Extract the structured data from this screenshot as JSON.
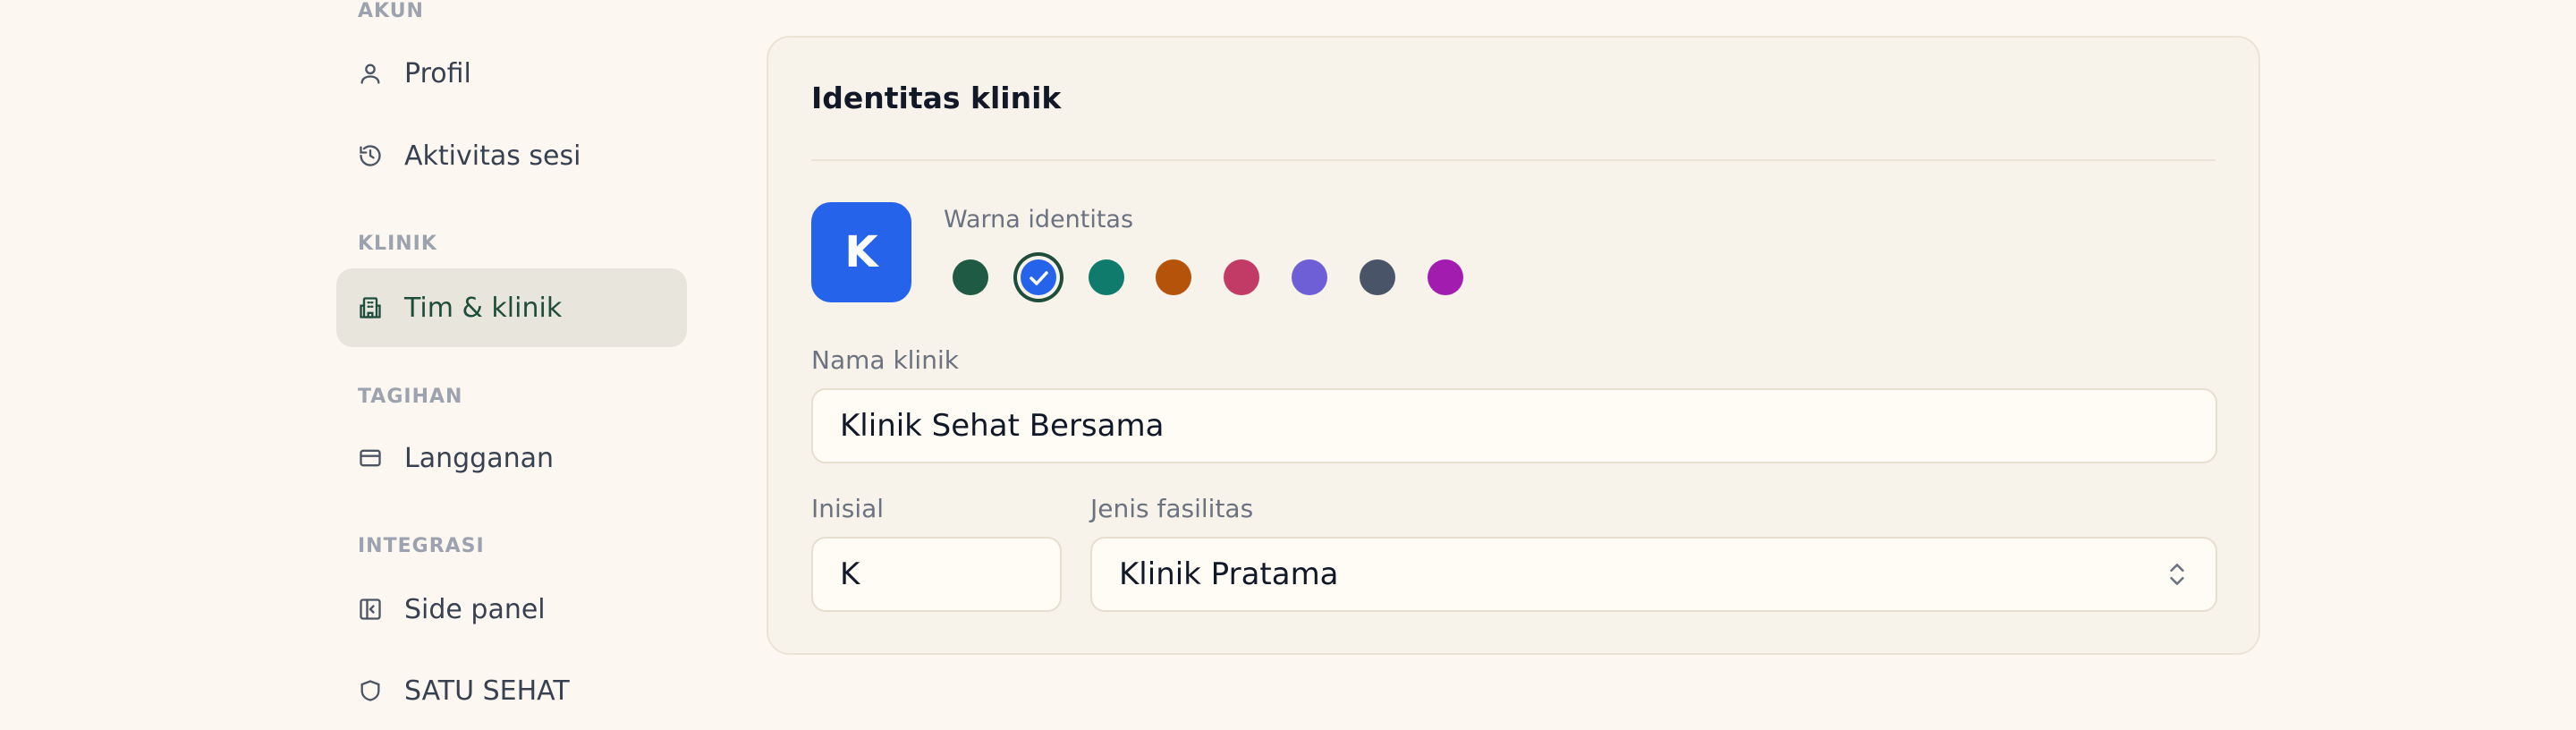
{
  "sidebar": {
    "sections": {
      "akun": "AKUN",
      "klinik": "KLINIK",
      "tagihan": "TAGIHAN",
      "integrasi": "INTEGRASI"
    },
    "items": {
      "profil": "Profil",
      "aktivitas": "Aktivitas sesi",
      "tim": "Tim & klinik",
      "langganan": "Langganan",
      "side_panel": "Side panel",
      "satusehat": "SATU SEHAT"
    },
    "active_item": "tim"
  },
  "card": {
    "title": "Identitas klinik",
    "avatar_initial": "K",
    "avatar_color": "#2563eb",
    "swatch_label": "Warna identitas",
    "swatches": [
      "#1f5a45",
      "#2563eb",
      "#0f7b6c",
      "#b45309",
      "#c23a66",
      "#6e5fd6",
      "#4a5468",
      "#a21caf"
    ],
    "selected_swatch": "#2563eb",
    "name_label": "Nama klinik",
    "name_value": "Klinik Sehat Bersama",
    "initial_label": "Inisial",
    "initial_value": "K",
    "facility_label": "Jenis fasilitas",
    "facility_value": "Klinik Pratama"
  },
  "icons": [
    "user-icon",
    "history-icon",
    "building-icon",
    "card-icon",
    "side-panel-icon",
    "shield-icon",
    "check-icon",
    "chevron-updown-icon"
  ]
}
